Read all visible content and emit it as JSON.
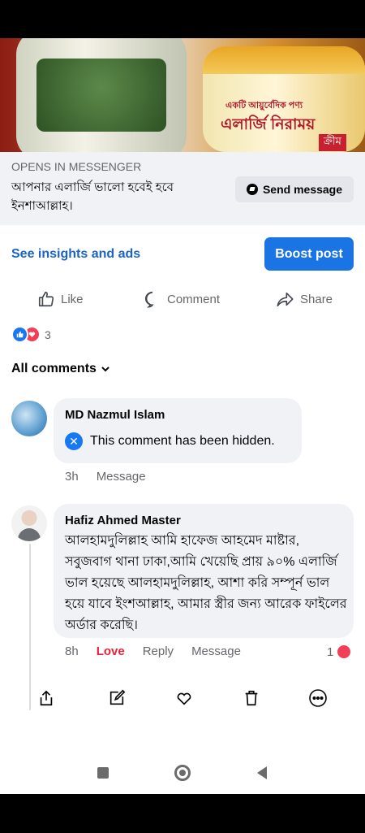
{
  "ad": {
    "jar_text_line1": "একটি আয়ুর্বেদিক পণ্য",
    "jar_text_line2": "এলার্জি নিরাময়",
    "jar_text_line3": "ক্রীম",
    "cta_eyebrow": "OPENS IN MESSENGER",
    "cta_title": "আপনার এলার্জি ভালো হবেই হবে ইনশাআল্লাহ।",
    "send_message_label": "Send message"
  },
  "post_actions": {
    "insights_label": "See insights and ads",
    "boost_label": "Boost post",
    "like_label": "Like",
    "comment_label": "Comment",
    "share_label": "Share",
    "reaction_count": "3"
  },
  "comments_header": {
    "label": "All comments"
  },
  "comments": [
    {
      "author": "MD Nazmul Islam",
      "hidden_text": "This comment has been hidden.",
      "time": "3h",
      "message_label": "Message"
    },
    {
      "author": "Hafiz Ahmed Master",
      "text": "আলহামদুলিল্লাহ আমি হাফেজ আহমেদ মাষ্টার, সবুজবাগ থানা ঢাকা,আমি খেয়েছি প্রায় ৯০% এলার্জি ভাল হয়েছে আলহামদুলিল্লাহ, আশা করি সম্পূর্ন ভাল হয়ে যাবে ইংশআল্লাহ, আমার স্ত্রীর জন্য আরেক ফাইলের অর্ডার করেছি।",
      "time": "8h",
      "love_label": "Love",
      "reply_label": "Reply",
      "message_label": "Message",
      "love_count": "1"
    }
  ],
  "colors": {
    "accent_blue": "#1b74e4",
    "link_blue": "#1a63c9",
    "love_red": "#f33e58"
  },
  "icons": {
    "toolbar": [
      "share-out-icon",
      "edit-icon",
      "heart-icon",
      "trash-icon",
      "more-icon"
    ],
    "nav": [
      "recent-apps-icon",
      "home-icon",
      "back-icon"
    ]
  }
}
